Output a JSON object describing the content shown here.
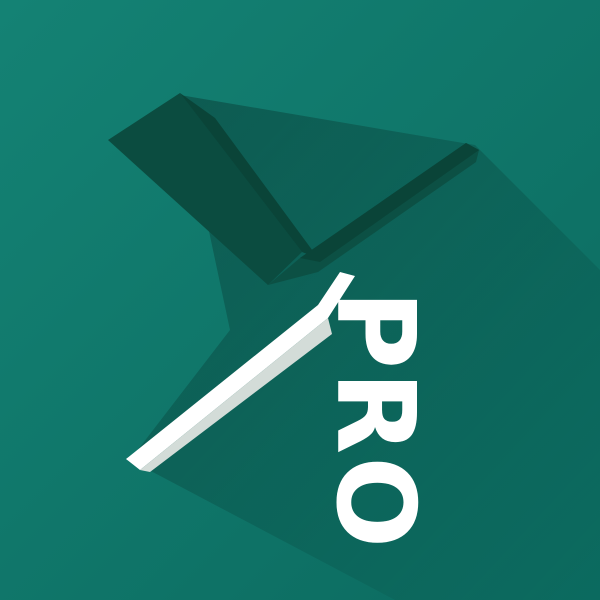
{
  "logo": {
    "badge_text": "PRO",
    "background_color": "#12796d",
    "background_color_dark": "#0a5f55",
    "mark_color_dark": "#0b4c40",
    "mark_color_shade": "#0f5e52",
    "mark_color_light": "#ffffff",
    "mark_color_light_shade": "#d8dfdc",
    "text_color": "#ffffff"
  }
}
